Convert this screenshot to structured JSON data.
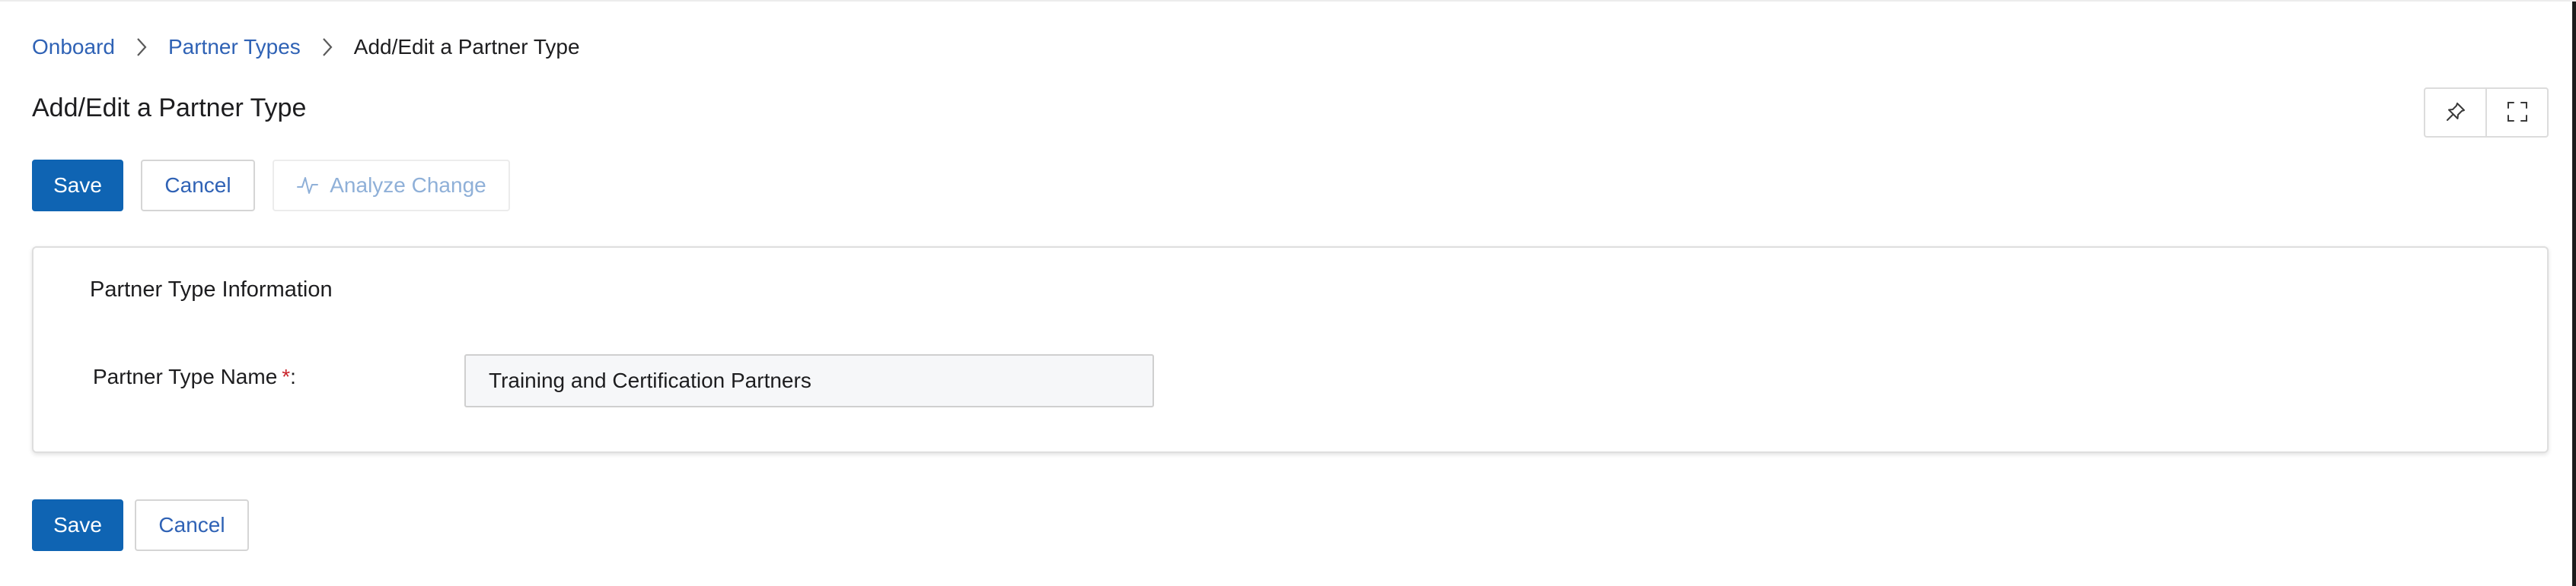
{
  "breadcrumb": {
    "items": [
      {
        "label": "Onboard"
      },
      {
        "label": "Partner Types"
      }
    ],
    "current": "Add/Edit a Partner Type"
  },
  "page": {
    "title": "Add/Edit a Partner Type"
  },
  "toolbar": {
    "save_label": "Save",
    "cancel_label": "Cancel",
    "analyze_label": "Analyze Change"
  },
  "panel": {
    "title": "Partner Type Information",
    "fields": [
      {
        "label": "Partner Type Name",
        "required_marker": "*",
        "suffix": ":",
        "value": "Training and Certification Partners"
      }
    ]
  },
  "footer": {
    "save_label": "Save",
    "cancel_label": "Cancel"
  },
  "icons": {
    "breadcrumb_separator": "chevron-right-icon",
    "pin": "pin-icon",
    "fullscreen": "fullscreen-icon",
    "analyze": "activity-icon"
  },
  "colors": {
    "primary": "#0f64b3",
    "link": "#2f62b5",
    "required": "#c9252c",
    "disabled_text": "#8fb0d8"
  }
}
